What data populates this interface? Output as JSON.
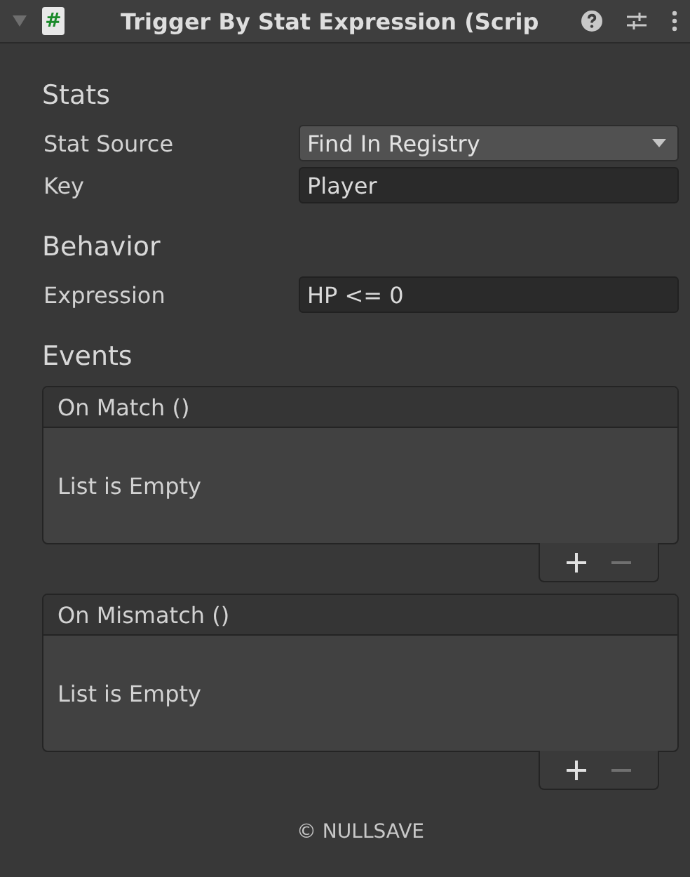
{
  "header": {
    "expanded": true,
    "script_glyph": "#",
    "title": "Trigger By Stat Expression (Scrip"
  },
  "sections": [
    {
      "title": "Stats",
      "fields": [
        {
          "kind": "dropdown",
          "label": "Stat Source",
          "value": "Find In Registry"
        },
        {
          "kind": "text",
          "label": "Key",
          "value": "Player"
        }
      ]
    },
    {
      "title": "Behavior",
      "fields": [
        {
          "kind": "text",
          "label": "Expression",
          "value": "HP <= 0"
        }
      ]
    }
  ],
  "events": {
    "title": "Events",
    "lists": [
      {
        "title": "On Match ()",
        "empty_text": "List is Empty",
        "add_disabled": false,
        "remove_disabled": true
      },
      {
        "title": "On Mismatch ()",
        "empty_text": "List is Empty",
        "add_disabled": false,
        "remove_disabled": true
      }
    ]
  },
  "footer": "© NULLSAVE"
}
